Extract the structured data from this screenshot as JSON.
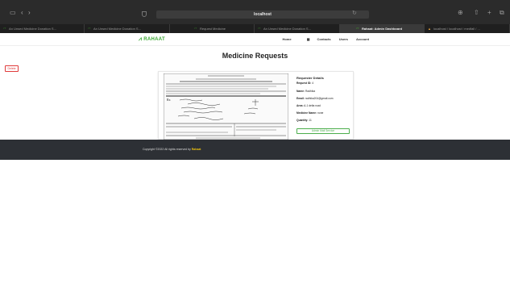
{
  "browser": {
    "url": "localhost",
    "tabs": [
      {
        "label": "An Unsed Medicine Donation S...",
        "active": false
      },
      {
        "label": "An Unsed Medicine Donation S...",
        "active": false
      },
      {
        "label": "Request Medicine",
        "active": false
      },
      {
        "label": "An Unsed Medicine Donation S...",
        "active": false
      },
      {
        "label": "Rahaat: Admin Dashboard",
        "active": true
      },
      {
        "label": "localhost / localhost / medfall / ...",
        "active": false
      }
    ]
  },
  "header": {
    "logo": "RAHAAT",
    "nav": [
      "Home",
      "Contacts",
      "Users",
      "Account"
    ]
  },
  "page": {
    "title": "Medicine Requests",
    "delete_label": "Delete"
  },
  "request": {
    "heading": "Requester Details",
    "request_id_label": "Request ID:",
    "request_id": "4",
    "name_label": "Name:",
    "name": "Radhika",
    "email_label": "Email:",
    "email": "radhika204@gmail.com",
    "area_label": "Area:",
    "area": "A-1 delta road",
    "medicine_label": "Medicine Name:",
    "medicine": "none",
    "quantity_label": "Quantity:",
    "quantity": "11",
    "admin_button": "Admin Mail Service"
  },
  "footer": {
    "text": "Copyright ©2022 All rights reserved by",
    "brand": "Rahaat"
  },
  "colors": {
    "accent_green": "#4cae4c",
    "delete_red": "#e03a3a",
    "footer_bg": "#2d3035",
    "brand_yellow": "#f0c40f"
  }
}
